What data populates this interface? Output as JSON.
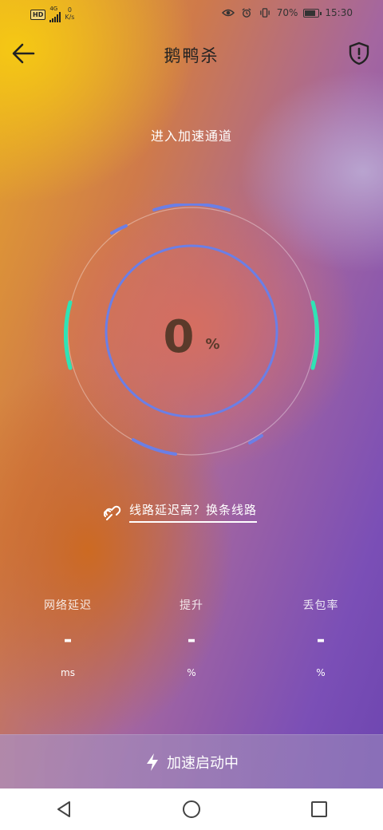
{
  "status_bar": {
    "hd_badge": "HD",
    "network_type": "4G",
    "net_speed_value": "0",
    "net_speed_unit": "K/s",
    "battery_percent": "70%",
    "time": "15:30"
  },
  "header": {
    "title": "鹅鸭杀",
    "back_icon": "arrow-left-icon",
    "right_icon": "shield-alert-icon"
  },
  "channel_label": "进入加速通道",
  "gauge": {
    "value": "0",
    "unit": "%",
    "ring_color": "#6b7fe6",
    "side_color": "#2fe3b5"
  },
  "switch_line": {
    "icon": "link-icon",
    "text": "线路延迟高？换条线路"
  },
  "stats": [
    {
      "label": "网络延迟",
      "value": "-",
      "unit": "ms"
    },
    {
      "label": "提升",
      "value": "-",
      "unit": "%"
    },
    {
      "label": "丢包率",
      "value": "-",
      "unit": "%"
    }
  ],
  "action": {
    "icon": "lightning-icon",
    "label": "加速启动中"
  },
  "nav": {
    "back_icon": "triangle-back-icon",
    "home_icon": "circle-home-icon",
    "recent_icon": "square-recent-icon"
  }
}
